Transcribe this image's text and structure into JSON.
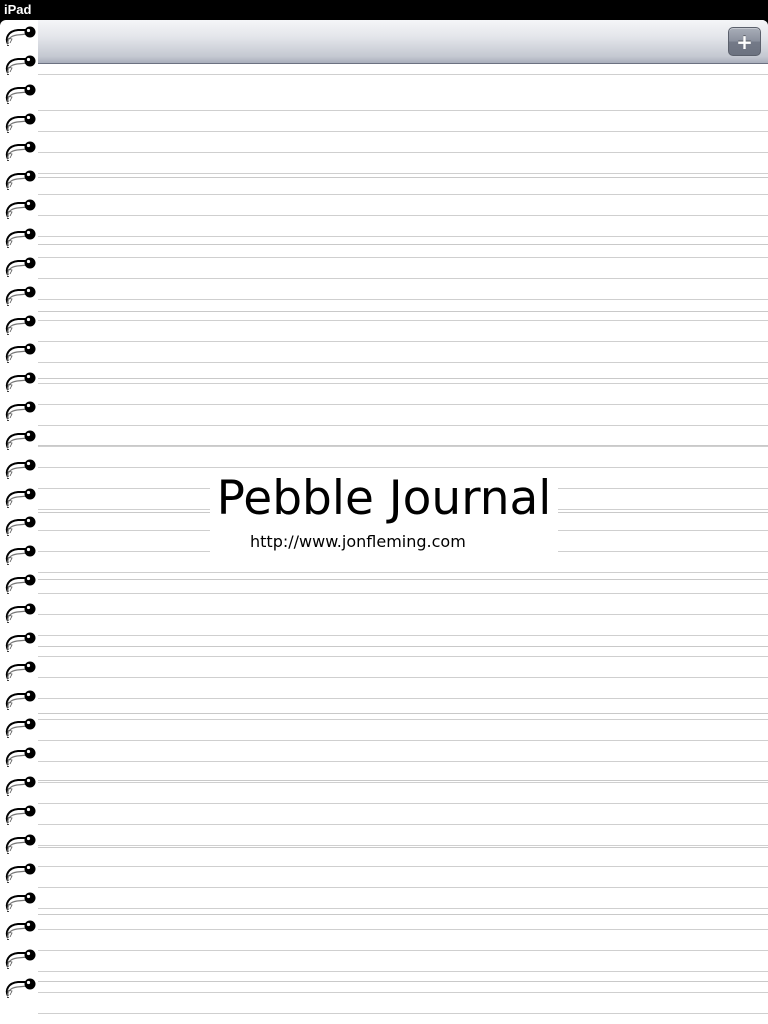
{
  "status_bar": {
    "device_label": "iPad"
  },
  "navbar": {
    "add_button_symbol": "+",
    "add_button_icon": "plus-icon"
  },
  "journal": {
    "title": "Pebble Journal",
    "url": "http://www.jonfleming.com"
  },
  "spiral": {
    "icon": "spiral-binding-ring-icon"
  },
  "colors": {
    "paper": "#ffffff",
    "rule_line": "#cfcfcf",
    "status_bar": "#000000",
    "navbar_top": "#f5f6f8",
    "navbar_bottom": "#a9aebb",
    "button": "#7a808d"
  }
}
